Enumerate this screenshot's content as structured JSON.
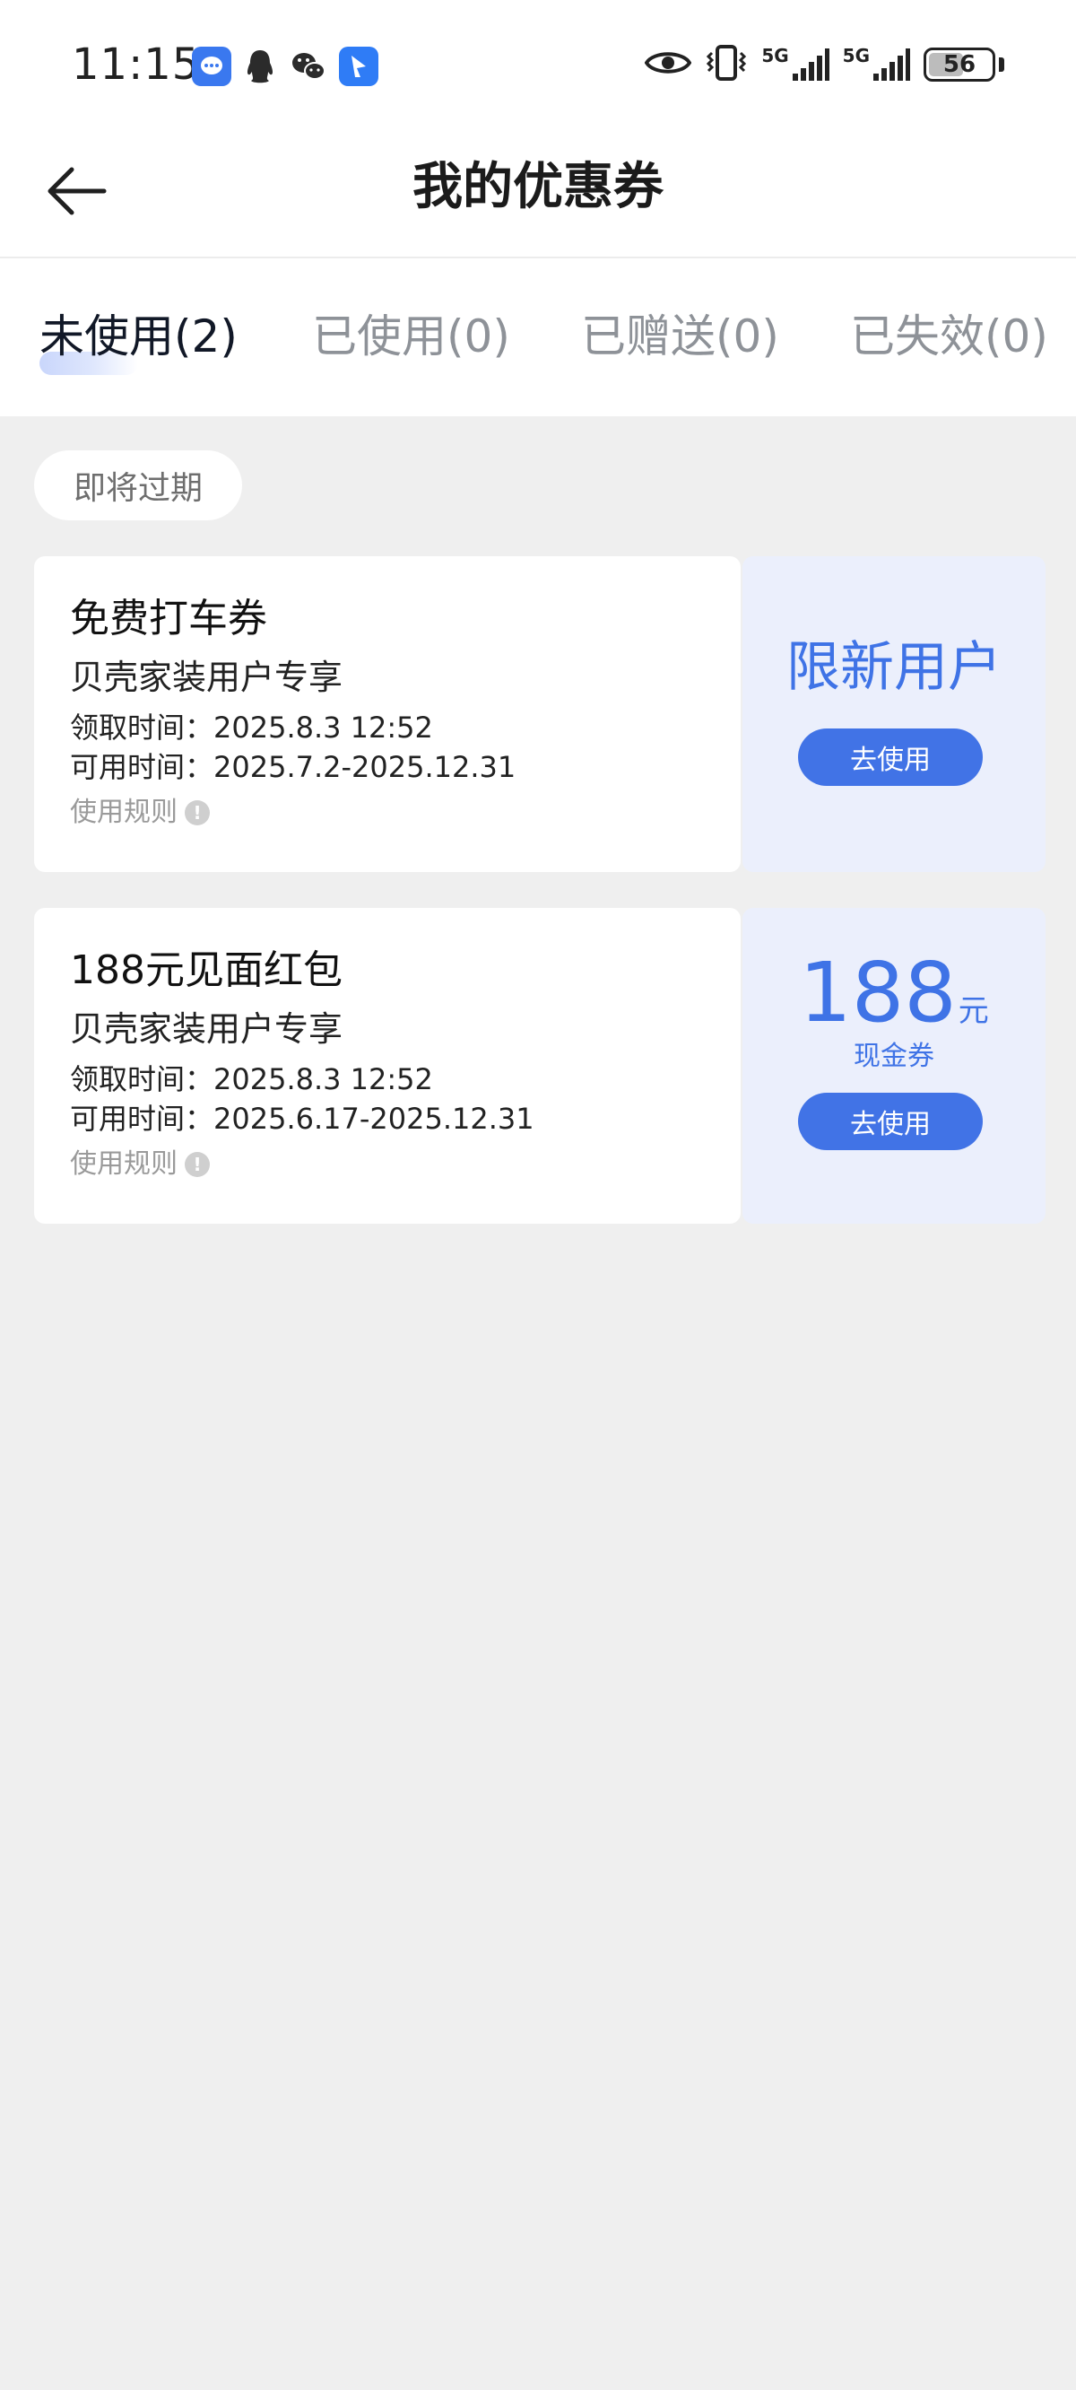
{
  "status_bar": {
    "time": "11:15",
    "network_1": "5G",
    "network_2": "5G",
    "battery": "56",
    "battery_level": 0.56,
    "icons": [
      "message-icon",
      "qq-icon",
      "wechat-icon",
      "app-icon",
      "eye-icon",
      "vibrate-icon",
      "signal-icon",
      "signal-icon",
      "battery-icon"
    ]
  },
  "header": {
    "title": "我的优惠券",
    "back_icon": "arrow-left-icon"
  },
  "tabs": [
    {
      "label": "未使用(2)",
      "active": true
    },
    {
      "label": "已使用(0)",
      "active": false
    },
    {
      "label": "已赠送(0)",
      "active": false
    },
    {
      "label": "已失效(0)",
      "active": false
    }
  ],
  "section": {
    "label": "即将过期"
  },
  "coupons": [
    {
      "title": "免费打车券",
      "subtitle": "贝壳家装用户专享",
      "received": "领取时间：2025.8.3 12:52",
      "valid": "可用时间：2025.7.2-2025.12.31",
      "rules": "使用规则",
      "badge": "限新用户",
      "button": "去使用"
    },
    {
      "title": "188元见面红包",
      "subtitle": "贝壳家装用户专享",
      "received": "领取时间：2025.8.3 12:52",
      "valid": "可用时间：2025.6.17-2025.12.31",
      "rules": "使用规则",
      "amount": "188",
      "amount_unit": "元",
      "amount_label": "现金券",
      "button": "去使用"
    }
  ],
  "colors": {
    "accent": "#4173e6",
    "coupon_side_bg": "#ebeffc",
    "page_bg": "#efefef"
  }
}
